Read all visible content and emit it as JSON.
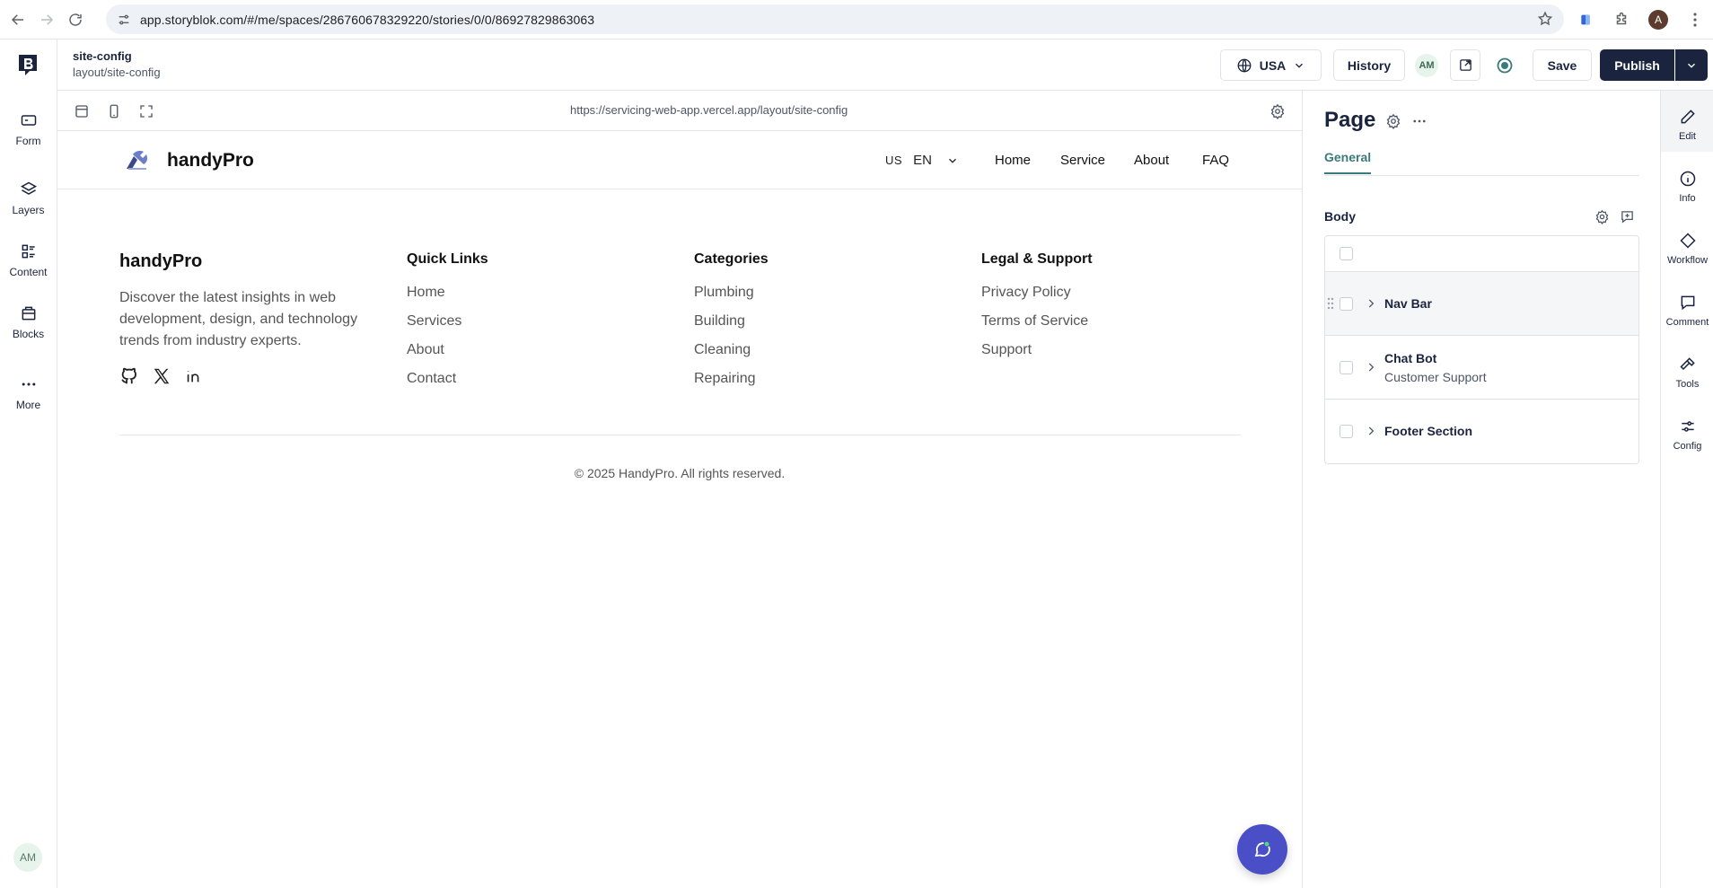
{
  "browser": {
    "url": "app.storyblok.com/#/me/spaces/286760678329220/stories/0/0/86927829863063",
    "profile_initial": "A"
  },
  "left_rail": {
    "items": [
      {
        "label": "Form",
        "icon": "form-icon"
      },
      {
        "label": "Layers",
        "icon": "layers-icon"
      },
      {
        "label": "Content",
        "icon": "content-icon"
      },
      {
        "label": "Blocks",
        "icon": "blocks-icon"
      },
      {
        "label": "More",
        "icon": "more-icon"
      }
    ],
    "avatar": "AM"
  },
  "header": {
    "story_name": "site-config",
    "story_slug": "layout/site-config",
    "language": "USA",
    "history_label": "History",
    "avatar": "AM",
    "save_label": "Save",
    "publish_label": "Publish"
  },
  "preview_toolbar": {
    "url": "https://servicing-web-app.vercel.app/layout/site-config"
  },
  "site": {
    "brand": "handyPro",
    "lang_flag": "US",
    "lang_code": "EN",
    "nav": [
      "Home",
      "Service",
      "About",
      "FAQ"
    ],
    "footer": {
      "brand": "handyPro",
      "description": "Discover the latest insights in web development, design, and technology trends from industry experts.",
      "columns": [
        {
          "title": "Quick Links",
          "links": [
            "Home",
            "Services",
            "About",
            "Contact"
          ]
        },
        {
          "title": "Categories",
          "links": [
            "Plumbing",
            "Building",
            "Cleaning",
            "Repairing"
          ]
        },
        {
          "title": "Legal & Support",
          "links": [
            "Privacy Policy",
            "Terms of Service",
            "Support"
          ]
        }
      ],
      "copyright": "© 2025 HandyPro. All rights reserved."
    }
  },
  "panel": {
    "title": "Page",
    "tab": "General",
    "body_label": "Body",
    "blocks": [
      {
        "name": "Nav Bar",
        "subtitle": ""
      },
      {
        "name": "Chat Bot",
        "subtitle": "Customer Support"
      },
      {
        "name": "Footer Section",
        "subtitle": ""
      }
    ]
  },
  "right_rail": {
    "items": [
      {
        "label": "Edit",
        "icon": "pencil-icon"
      },
      {
        "label": "Info",
        "icon": "info-icon"
      },
      {
        "label": "Workflow",
        "icon": "diamond-icon"
      },
      {
        "label": "Comment",
        "icon": "comment-icon"
      },
      {
        "label": "Tools",
        "icon": "hammer-icon"
      },
      {
        "label": "Config",
        "icon": "sliders-icon"
      }
    ]
  },
  "colors": {
    "primary": "#1b243f",
    "accent_teal": "#3b7a7a",
    "chat_fab": "#4a4fc7"
  }
}
